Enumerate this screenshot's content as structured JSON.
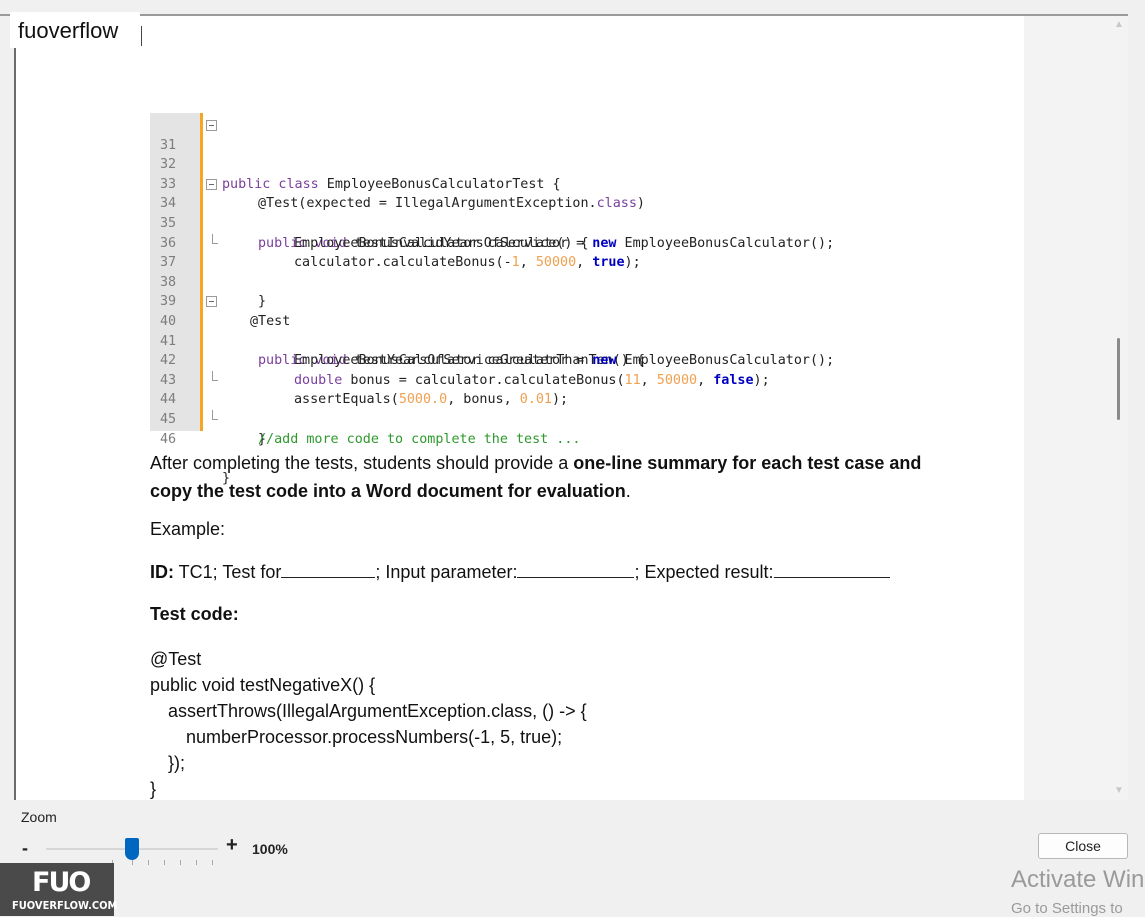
{
  "search": {
    "value": "fuoverflow"
  },
  "code": {
    "lines": [
      {
        "num": "31",
        "text": "public class EmployeeBonusCalculatorTest {"
      },
      {
        "num": "32",
        "text": ""
      },
      {
        "num": "33",
        "text": "@Test(expected = IllegalArgumentException.class)"
      },
      {
        "num": "34",
        "text": "public void testInvalidYearsOfService() {"
      },
      {
        "num": "35",
        "text": "EmployeeBonusCalculator calculator = new EmployeeBonusCalculator();"
      },
      {
        "num": "36",
        "text": "calculator.calculateBonus(-1, 50000, true);"
      },
      {
        "num": "37",
        "text": "}"
      },
      {
        "num": "38",
        "text": ""
      },
      {
        "num": "39",
        "text": "@Test"
      },
      {
        "num": "40",
        "text": "public void testYearsOfServiceGreaterThanTen() {"
      },
      {
        "num": "41",
        "text": "EmployeeBonusCalculator calculator = new EmployeeBonusCalculator();"
      },
      {
        "num": "42",
        "text": "double bonus = calculator.calculateBonus(11, 50000, false);"
      },
      {
        "num": "43",
        "text": "assertEquals(5000.0, bonus, 0.01);"
      },
      {
        "num": "44",
        "text": "}"
      },
      {
        "num": "45",
        "text": "//add more code to complete the test ..."
      },
      {
        "num": "46",
        "text": "}"
      }
    ]
  },
  "doc": {
    "para1_plain": "After completing the tests, students should provide a ",
    "para1_bold_a": "one-line summary for each test case and",
    "para1_bold_b": "copy the test code into a Word document for evaluation",
    "para1_end": ".",
    "example": "Example:",
    "id_label": "ID:",
    "id_text1": " TC1; Test for",
    "id_text2": "; Input parameter:",
    "id_text3": "; Expected result:",
    "test_code_label": "Test code:",
    "snippet": [
      "@Test",
      "public void testNegativeX() {",
      "assertThrows(IllegalArgumentException.class, () -> {",
      "numberProcessor.processNumbers(-1, 5, true);",
      "});",
      "}"
    ]
  },
  "zoom": {
    "label": "Zoom",
    "minus": "-",
    "plus": "+",
    "value": "100%",
    "level_fraction": 0.46
  },
  "buttons": {
    "close": "Close"
  },
  "watermark": {
    "line1": "Activate Win",
    "line2": "Go to Settings to"
  },
  "logo": {
    "mark": "FUO",
    "text": "FUOVERFLOW.COM"
  }
}
